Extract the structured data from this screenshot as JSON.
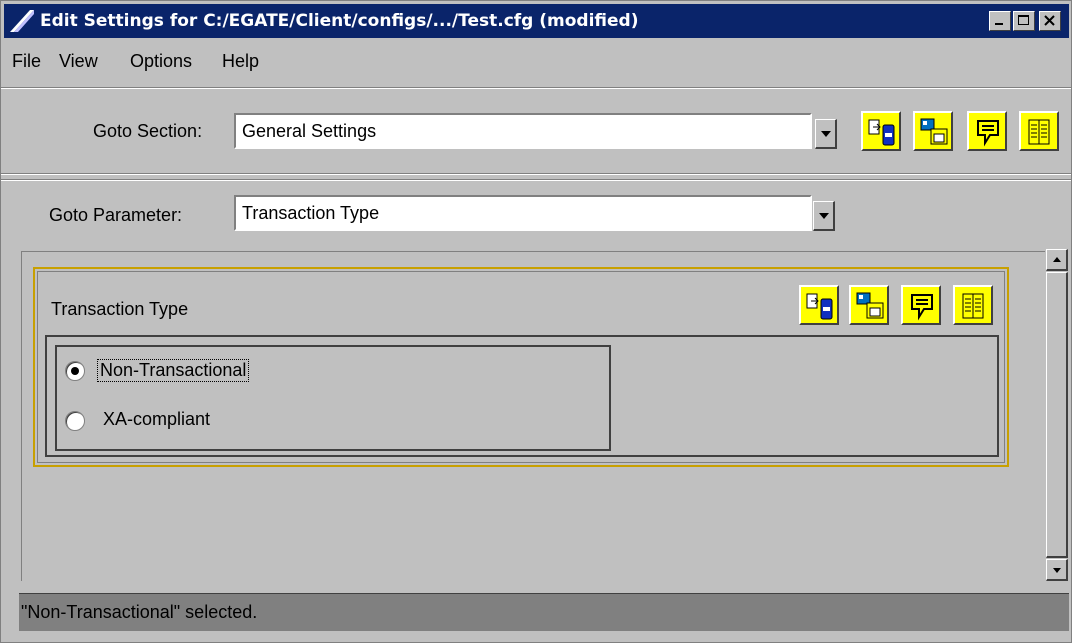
{
  "window": {
    "title": "Edit Settings for C:/EGATE/Client/configs/.../Test.cfg (modified)"
  },
  "menu": [
    "File",
    "View",
    "Options",
    "Help"
  ],
  "goto_section": {
    "label": "Goto Section:",
    "value": "General Settings"
  },
  "goto_parameter": {
    "label": "Goto Parameter:",
    "value": "Transaction Type"
  },
  "parameter": {
    "title": "Transaction Type",
    "options": [
      {
        "label": "Non-Transactional",
        "selected": true
      },
      {
        "label": "XA-compliant",
        "selected": false
      }
    ]
  },
  "status": {
    "text": "\"Non-Transactional\" selected."
  }
}
